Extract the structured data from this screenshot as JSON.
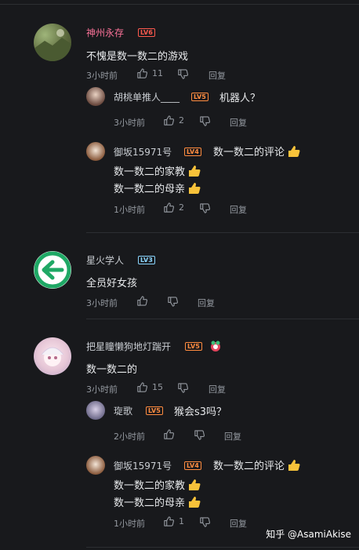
{
  "comments": [
    {
      "username": "神州永存",
      "level": "LV6",
      "text": "不愧是数一数二的游戏",
      "time": "3小时前",
      "likes": "11",
      "reply_label": "回复",
      "replies": [
        {
          "username": "胡桃单推人____",
          "level": "LV5",
          "text": "机器人？",
          "time": "3小时前",
          "likes": "2",
          "reply_label": "回复"
        },
        {
          "username": "御坂15971号",
          "level": "LV4",
          "lines": [
            "数一数二的评论",
            "数一数二的家教",
            "数一数二的母亲"
          ],
          "time": "1小时前",
          "likes": "2",
          "reply_label": "回复"
        }
      ]
    },
    {
      "username": "星火学人",
      "level": "LV3",
      "text": "全员好女孩",
      "time": "3小时前",
      "likes": "",
      "reply_label": "回复",
      "replies": []
    },
    {
      "username": "把星瞳懒狗地灯踹开",
      "level": "LV5",
      "text": "数一数二的",
      "time": "3小时前",
      "likes": "15",
      "reply_label": "回复",
      "replies": [
        {
          "username": "琁歌",
          "level": "LV5",
          "text": "猴会s3吗？",
          "time": "2小时前",
          "likes": "",
          "reply_label": "回复"
        },
        {
          "username": "御坂15971号",
          "level": "LV4",
          "lines": [
            "数一数二的评论",
            "数一数二的家教",
            "数一数二的母亲"
          ],
          "time": "1小时前",
          "likes": "1",
          "reply_label": "回复"
        }
      ]
    }
  ],
  "watermark": "知乎 @AsamiAkise",
  "colors": {
    "background": "#18191c",
    "vip_name": "#fb7299",
    "meta": "#9499a0",
    "text": "#e7e9eb"
  }
}
